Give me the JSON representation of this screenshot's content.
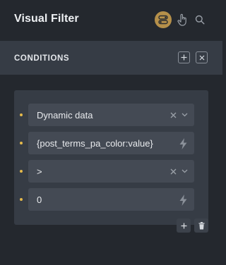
{
  "header": {
    "title": "Visual Filter",
    "icons": [
      "toggle-icon",
      "hand-pointer-icon",
      "search-icon"
    ],
    "accent": "#b5904a"
  },
  "conditions": {
    "title": "CONDITIONS",
    "add_icon": "plus-icon",
    "close_icon": "close-icon"
  },
  "rows": [
    {
      "type": "select",
      "value": "Dynamic data"
    },
    {
      "type": "input",
      "value": "{post_terms_pa_color:value}"
    },
    {
      "type": "select",
      "value": ">"
    },
    {
      "type": "input",
      "value": "0"
    }
  ],
  "footer": {
    "add_icon": "plus-icon",
    "delete_icon": "trash-icon"
  },
  "colors": {
    "background": "#24282e",
    "panel": "#363c45",
    "field": "#444a54",
    "bullet": "#e5b94b"
  }
}
